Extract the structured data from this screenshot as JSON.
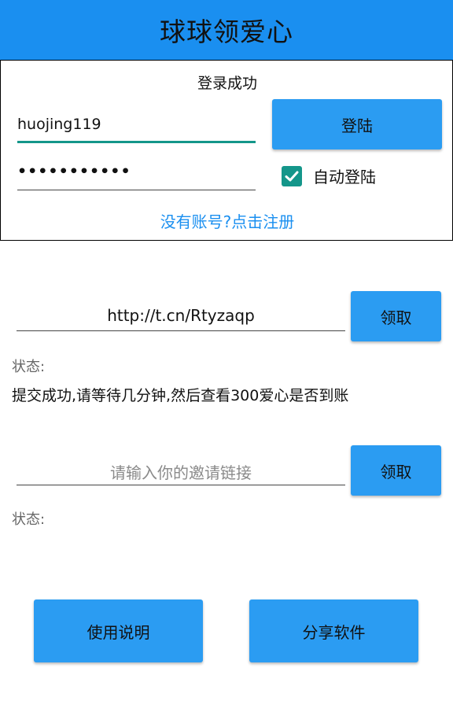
{
  "app": {
    "title": "球球领爱心"
  },
  "login": {
    "status": "登录成功",
    "username": "huojing119",
    "password_masked": "•••••••••••",
    "login_label": "登陆",
    "auto_login_label": "自动登陆",
    "auto_login_checked": true,
    "register_link": "没有账号?点击注册"
  },
  "claim1": {
    "url_value": "http://t.cn/Rtyzaqp",
    "button_label": "领取",
    "status_label": "状态:",
    "status_message": "提交成功,请等待几分钟,然后查看300爱心是否到账"
  },
  "claim2": {
    "placeholder": "请输入你的邀请链接",
    "button_label": "领取",
    "status_label": "状态:"
  },
  "footer": {
    "instructions_label": "使用说明",
    "share_label": "分享软件"
  },
  "colors": {
    "appbar": "#1a8ff0",
    "button": "#2b9cf2",
    "accent": "#14968a",
    "link": "#1a8ff0"
  }
}
